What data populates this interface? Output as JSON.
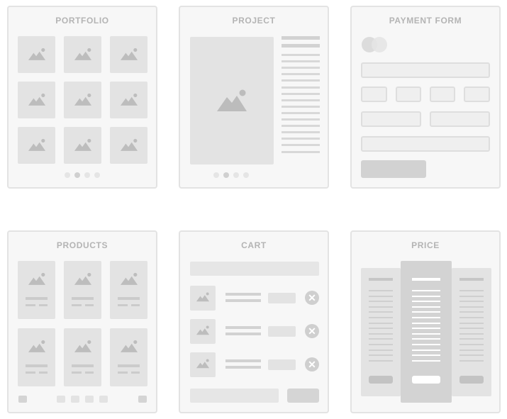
{
  "cards": {
    "portfolio": {
      "title": "PORTFOLIO",
      "images": 9,
      "dots": 4,
      "active_dot": 1
    },
    "project": {
      "title": "PROJECT",
      "text_lines": 18,
      "dots": 4,
      "active_dot": 1
    },
    "payment_form": {
      "title": "PAYMENT FORM"
    },
    "products": {
      "title": "PRODUCTS",
      "items": 6,
      "pages": 4
    },
    "cart": {
      "title": "CART",
      "items": 3,
      "remove_glyph": "✕"
    },
    "price": {
      "title": "PRICE",
      "columns": 3,
      "highlighted_column": 1
    }
  },
  "colors": {
    "card_bg": "#f7f7f7",
    "card_border": "#e3e3e3",
    "placeholder": "#e3e3e3",
    "title_text": "#b4b4b4",
    "highlight_column": "#d3d3d3"
  },
  "icons": {
    "image": "mountain-image-icon",
    "card_brand": "credit-card-circles-icon",
    "remove": "close-circle-icon"
  }
}
